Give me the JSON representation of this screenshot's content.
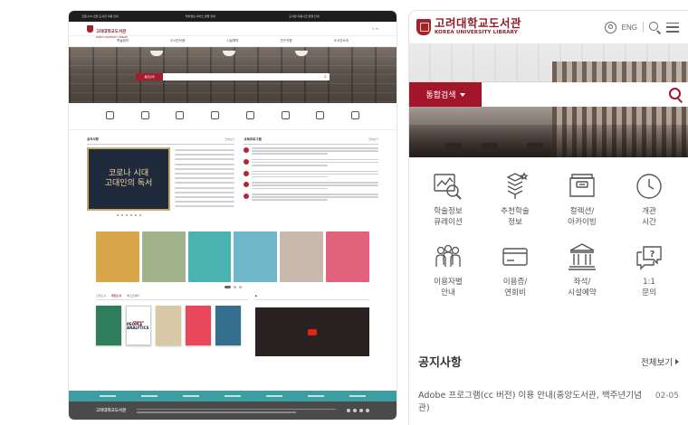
{
  "desktop": {
    "topbar": [
      "코로나19 관련 도서관 이용 안내",
      "학술정보 서비스 변경 안내",
      "도서관 이용시간 변경 안내"
    ],
    "logo": {
      "ko": "고려대학교도서관",
      "en": "KOREA UNIVERSITY LIBRARY"
    },
    "nav": [
      "학술정보",
      "도서관이용",
      "시설예약",
      "연구지원",
      "도서관소개"
    ],
    "search_select": "통합검색",
    "notice_title": "공지사항",
    "program_title": "교육프로그램",
    "more": "전체보기",
    "banner_text": [
      "코로나 시대",
      "고대인의 독서"
    ],
    "tabs": [
      "신착도서",
      "추천도서",
      "베스트셀러"
    ],
    "book_title": "PEOPLE ANALYTICS",
    "book_sub": "PEOPLE",
    "card_colors": [
      "#d9a64a",
      "#9fb28a",
      "#4ab3b0",
      "#6fb7c9",
      "#c9b8ad",
      "#e2627e"
    ]
  },
  "mobile": {
    "logo": {
      "ko": "고려대학교도서관",
      "en": "KOREA UNIVERSITY LIBRARY"
    },
    "lang": "ENG",
    "search": {
      "select_label": "통합검색",
      "placeholder": ""
    },
    "tiles": [
      {
        "label": "학술정보\n큐레이션",
        "icon": "curation-icon"
      },
      {
        "label": "추천학술\n정보",
        "icon": "recommend-icon"
      },
      {
        "label": "컬렉션/\n아카이빙",
        "icon": "archive-icon"
      },
      {
        "label": "개관\n시간",
        "icon": "clock-icon"
      },
      {
        "label": "이용자별\n안내",
        "icon": "users-icon"
      },
      {
        "label": "이용증/\n연회비",
        "icon": "card-icon"
      },
      {
        "label": "좌석/\n시설예약",
        "icon": "building-icon"
      },
      {
        "label": "1:1\n문의",
        "icon": "inquiry-icon"
      }
    ],
    "notice": {
      "title": "공지사항",
      "more": "전체보기",
      "items": [
        {
          "text": "Adobe 프로그램(cc 버전) 이용 안내(중앙도서관, 백주년기념관)",
          "date": "02-05"
        }
      ]
    }
  },
  "colors": {
    "brand": "#a3152a",
    "teal": "#3c9ea0"
  }
}
